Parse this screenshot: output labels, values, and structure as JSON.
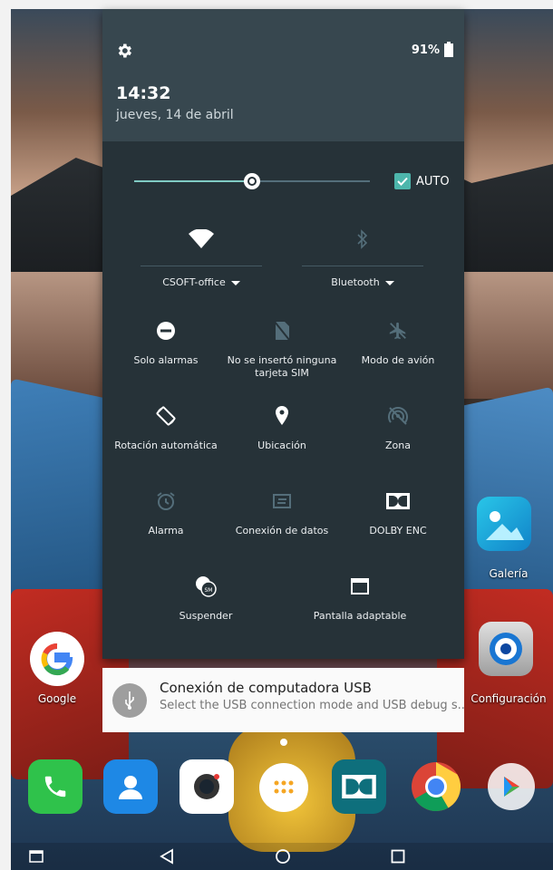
{
  "status": {
    "battery_percent": "91%"
  },
  "shade": {
    "time": "14:32",
    "date": "jueves, 14 de abril",
    "brightness": {
      "level": 0.5,
      "auto_label": "AUTO",
      "auto_checked": true
    },
    "wifi": {
      "label": "CSOFT-office",
      "icon": "wifi-icon"
    },
    "bluetooth": {
      "label": "Bluetooth",
      "icon": "bluetooth-icon"
    },
    "tiles": [
      {
        "label": "Solo alarmas",
        "icon": "do-not-disturb-icon",
        "active": true
      },
      {
        "label": "No se insertó ninguna tarjeta SIM",
        "icon": "no-sim-icon",
        "active": false
      },
      {
        "label": "Modo de avión",
        "icon": "airplane-icon",
        "active": false
      },
      {
        "label": "Rotación automática",
        "icon": "auto-rotate-icon",
        "active": true
      },
      {
        "label": "Ubicación",
        "icon": "location-icon",
        "active": true
      },
      {
        "label": "Zona",
        "icon": "hotspot-icon",
        "active": false
      },
      {
        "label": "Alarma",
        "icon": "alarm-icon",
        "active": false
      },
      {
        "label": "Conexión de datos",
        "icon": "data-connection-icon",
        "active": false
      },
      {
        "label": "DOLBY ENC",
        "icon": "dolby-icon",
        "active": true
      },
      {
        "label": "Suspender",
        "icon": "sleep-icon",
        "active": true
      },
      {
        "label": "Pantalla adaptable",
        "icon": "adaptive-display-icon",
        "active": true
      }
    ]
  },
  "notification": {
    "title": "Conexión de computadora USB",
    "body": "Select the USB connection mode and USB debug s.."
  },
  "home": {
    "apps": [
      {
        "label": "Galería",
        "icon": "gallery-icon"
      },
      {
        "label": "Google",
        "icon": "google-icon"
      },
      {
        "label": "Configuración",
        "icon": "settings-icon"
      }
    ],
    "dock": [
      "phone-icon",
      "contacts-icon",
      "camera-icon",
      "app-drawer-icon",
      "dolby-app-icon",
      "chrome-icon",
      "play-store-icon"
    ]
  },
  "colors": {
    "shade_bg": "#263238",
    "shade_header": "#37474f",
    "accent": "#80cbc4"
  }
}
